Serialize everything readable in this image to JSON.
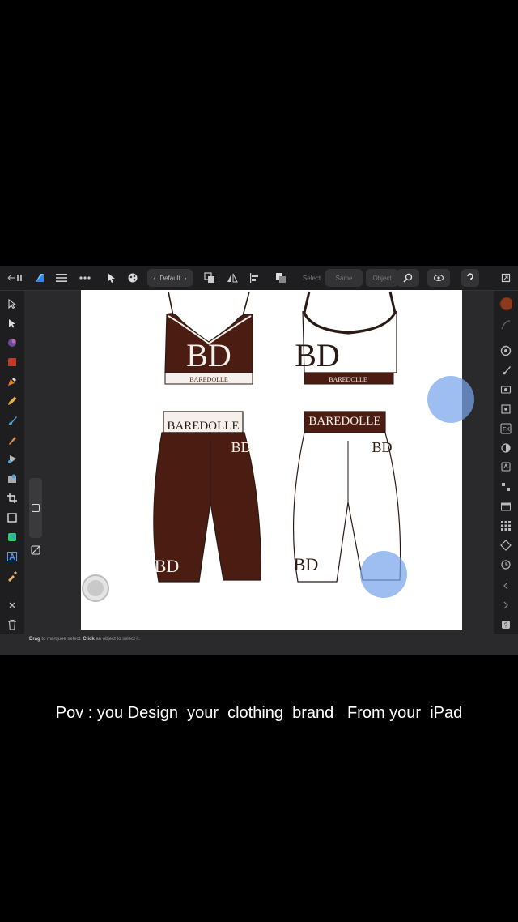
{
  "toolbar": {
    "preset_label": "Default",
    "select_label": "Select",
    "same_label": "Same",
    "object_label": "Object"
  },
  "design": {
    "brand_label": "BAREDOLLE",
    "monogram": "BD",
    "brown_color": "#4a1c12",
    "trim_color": "#f5f0eb"
  },
  "statusbar": {
    "prefix": "Drag",
    "middle": " to marquee select. ",
    "click_word": "Click",
    "suffix": " an object to select it."
  },
  "caption": {
    "text": "Pov : you Design  your  clothing  brand   From your  iPad"
  },
  "colors": {
    "accent": "#1e7cf0",
    "touch": "#78a5eb"
  }
}
